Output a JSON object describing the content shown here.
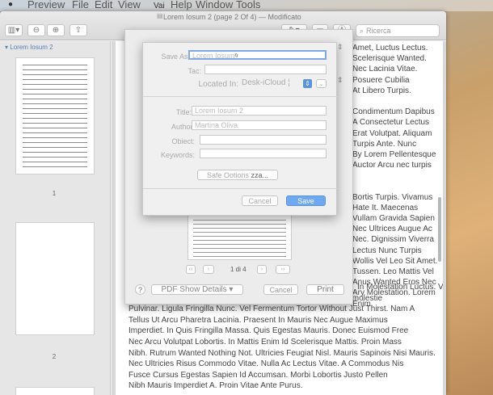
{
  "menubar": {
    "apple": "",
    "app": "Preview",
    "file": "File",
    "edit": "Edit",
    "view": "View",
    "go": "Vai",
    "help": "Help",
    "window": "Window",
    "tools": "Tools"
  },
  "window": {
    "title": "Lorem Iosum 2 (page 2 Of 4) — Modificato",
    "search_placeholder": "Ricerca"
  },
  "sidebar": {
    "heading": "Lorem Iosum 2",
    "page1": "1",
    "page2": "2"
  },
  "dialog": {
    "save_as_label": "Save As:",
    "save_as_value": "Lorem Iosum",
    "tag_label": "Tac:",
    "located_in_label": "Located In:",
    "located_in_value": "Desk-iCloud",
    "title_label": "Title:",
    "title_value": "Lorem Iosum 2",
    "author_label": "Author:",
    "author_value": "Martina Oliva",
    "object_label": "Obiect:",
    "keywords_label": "Keywords:",
    "safe_options": "Safe Ootions",
    "zza": "zza...",
    "cancel": "Cancel",
    "save": "Save"
  },
  "print_sheet": {
    "page_info": "1 di 4",
    "prev": "<<   <",
    "next": ">   >>",
    "help": "?",
    "pdf": "PDF Show Details",
    "cancel": "Cancel",
    "print": "Print"
  },
  "doc_right": [
    "Amet, Luctus Lectus.",
    "Scelerisque Wanted.",
    "Nec Lacinia Vitae.",
    "Posuere Cubilia",
    "At Libero Turpis.",
    "",
    "Condimentum Dapibus",
    "A Consectetur Lectus",
    "Erat Volutpat. Aliquam",
    "Turpis Ante. Nunc",
    "By Lorem Pellentesque",
    "Auctor Arcu nec turpis",
    "",
    "",
    "Bortis Turpis. Vivamus",
    "Hate It. Maecenas",
    "Vullam Gravida Sapien",
    "Nec Ultrices Augue Ac",
    "Nec. Dignissim Viverra",
    "Lectus Nunc Turpis",
    "Wollis Vel Leo Sit Amet.",
    "Tussen. Leo Mattis Vel",
    "Anus Wanted Eros Nec",
    "Ary Molestation. Lorem",
    "Enim."
  ],
  "doc_bottom": [
    "In Molestation Luctus. Vel",
    "Imperdiet lorem ipsum feugiat orci. Fusce dignissim, enim nec molestie",
    "Pulvinar. Ligula Fringilla Nunc. Vel Fermentum Tortor Without Just Thirst. Nam A",
    "Tellus Ut Arcu Pharetra Lacinia. Praesent In Mauris Nec Augue Maximus",
    "Imperdiet. In Quis Fringilla Massa. Quis Egestas Mauris. Donec Euismod Free",
    "Nec Arcu Volutpat Lobortis. In Mattis Enim Id Scelerisque Mattis. Proin Mass",
    "Nibh. Rutrum Wanted Nothing Not. Ultricies Feugiat Nisl. Mauris Sapinois Nisi Mauris.",
    "Nec Ultricies Risus Commodo Vitae. Nulla Ac Lectus Vitae. A Commodus Nis",
    "Fusce Cursus Egestas Sapien Id Accumsan. Morbi Lobortis Justo Pellen",
    "Nibh Mauris Imperdiet A. Proin Vitae Ante Purus."
  ]
}
